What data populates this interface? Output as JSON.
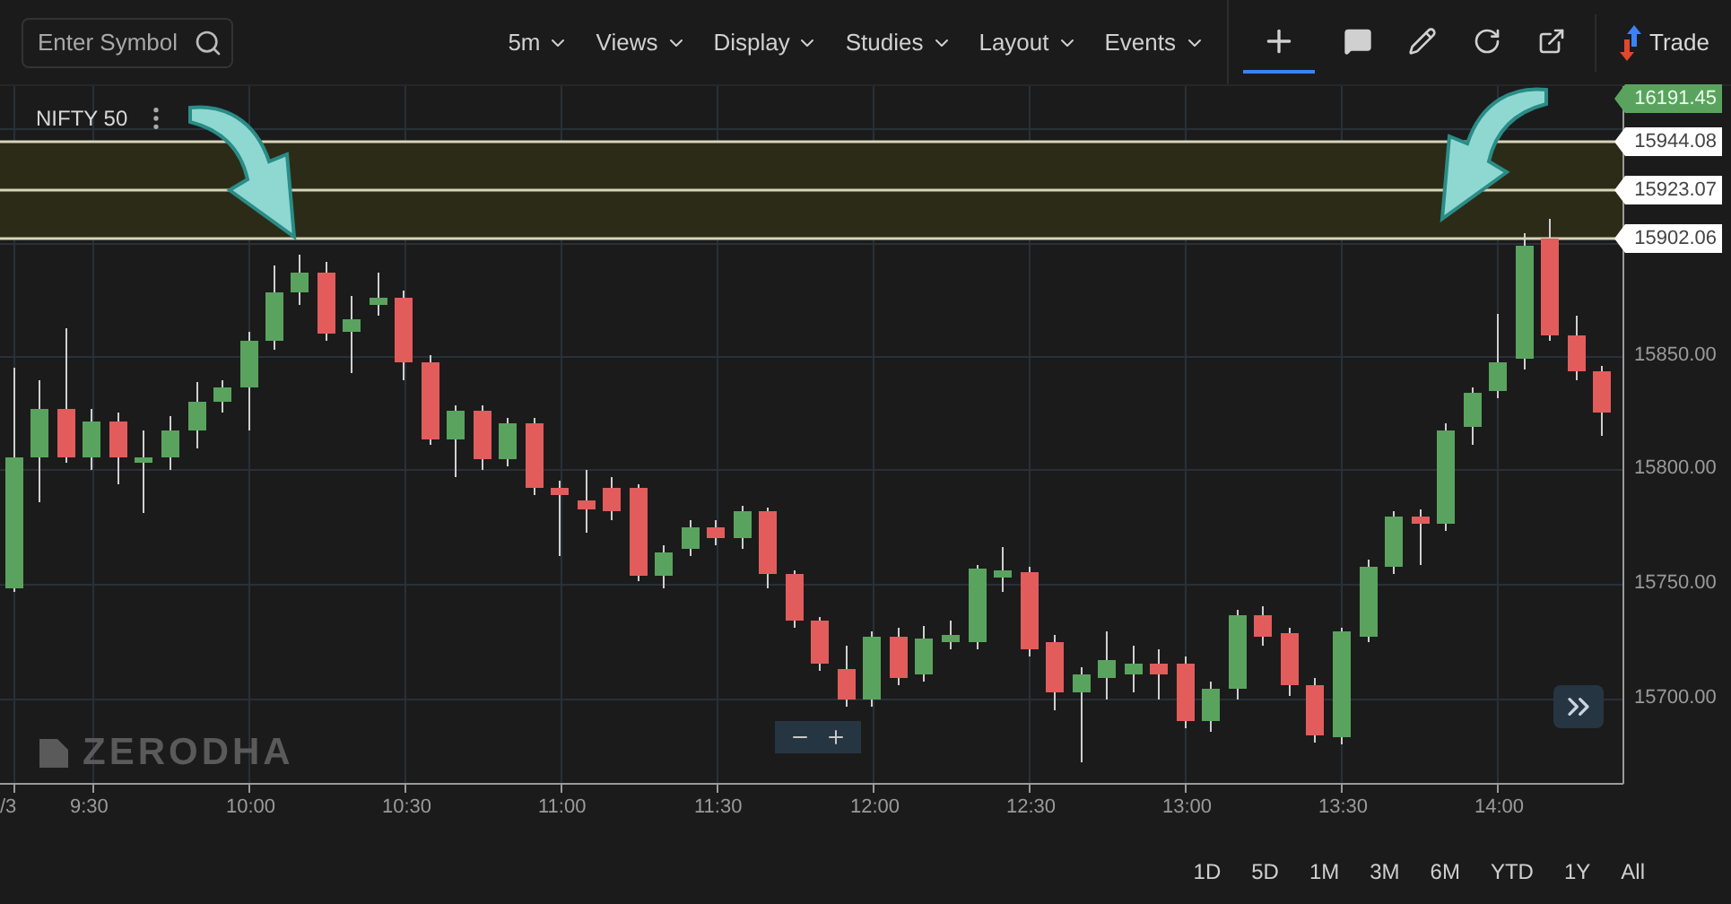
{
  "toolbar": {
    "search": {
      "placeholder": "Enter Symbol"
    },
    "menus": [
      {
        "label": "5m"
      },
      {
        "label": "Views"
      },
      {
        "label": "Display"
      },
      {
        "label": "Studies"
      },
      {
        "label": "Layout"
      },
      {
        "label": "Events"
      }
    ],
    "tools": [
      {
        "kind": "crosshair",
        "selected": true
      },
      {
        "kind": "comment",
        "selected": false
      },
      {
        "kind": "draw",
        "selected": false
      },
      {
        "kind": "reset",
        "selected": false
      },
      {
        "kind": "popout",
        "selected": false
      }
    ],
    "trade_button": "Trade"
  },
  "chart": {
    "symbol": "NIFTY 50",
    "watermark": "ZERODHA",
    "last_price": "16191.45",
    "levels": [
      {
        "price": "15944.08"
      },
      {
        "price": "15923.07"
      },
      {
        "price": "15902.06"
      }
    ],
    "y_axis_labels": [
      "15850.00",
      "15800.00",
      "15750.00",
      "15700.00"
    ],
    "x_axis_labels": [
      "/3",
      "9:30",
      "10:00",
      "10:30",
      "11:00",
      "11:30",
      "12:00",
      "12:30",
      "13:00",
      "13:30",
      "14:00"
    ]
  },
  "ranges": [
    {
      "label": "1D"
    },
    {
      "label": "5D"
    },
    {
      "label": "1M"
    },
    {
      "label": "3M"
    },
    {
      "label": "6M"
    },
    {
      "label": "YTD"
    },
    {
      "label": "1Y"
    },
    {
      "label": "All"
    }
  ]
}
